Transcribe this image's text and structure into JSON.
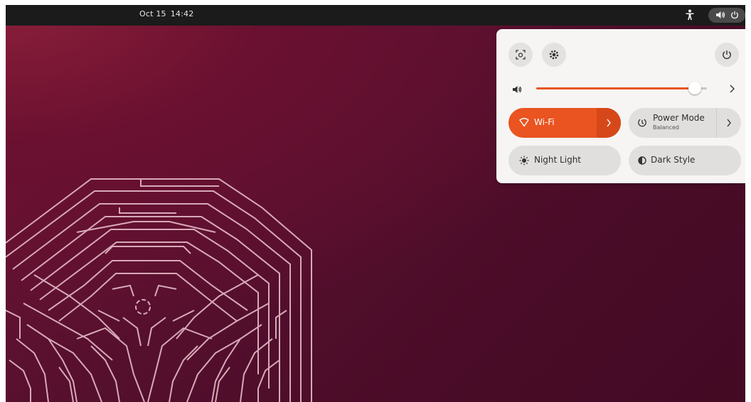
{
  "topbar": {
    "date": "Oct 15",
    "time": "14:42",
    "icons": [
      "accessibility-icon",
      "volume-icon",
      "power-icon"
    ]
  },
  "quick_settings": {
    "buttons": [
      "screenshot-icon",
      "settings-icon",
      "power-icon"
    ],
    "volume": {
      "level": 0.93
    },
    "toggles": {
      "wifi": {
        "label": "Wi-Fi",
        "active": true
      },
      "power_mode": {
        "label": "Power Mode",
        "sublabel": "Balanced"
      },
      "night_light": {
        "label": "Night Light"
      },
      "dark_style": {
        "label": "Dark Style"
      }
    }
  },
  "colors": {
    "accent": "#e95420",
    "topbar": "#1b1b1b",
    "wallpaper": "#56102e"
  }
}
